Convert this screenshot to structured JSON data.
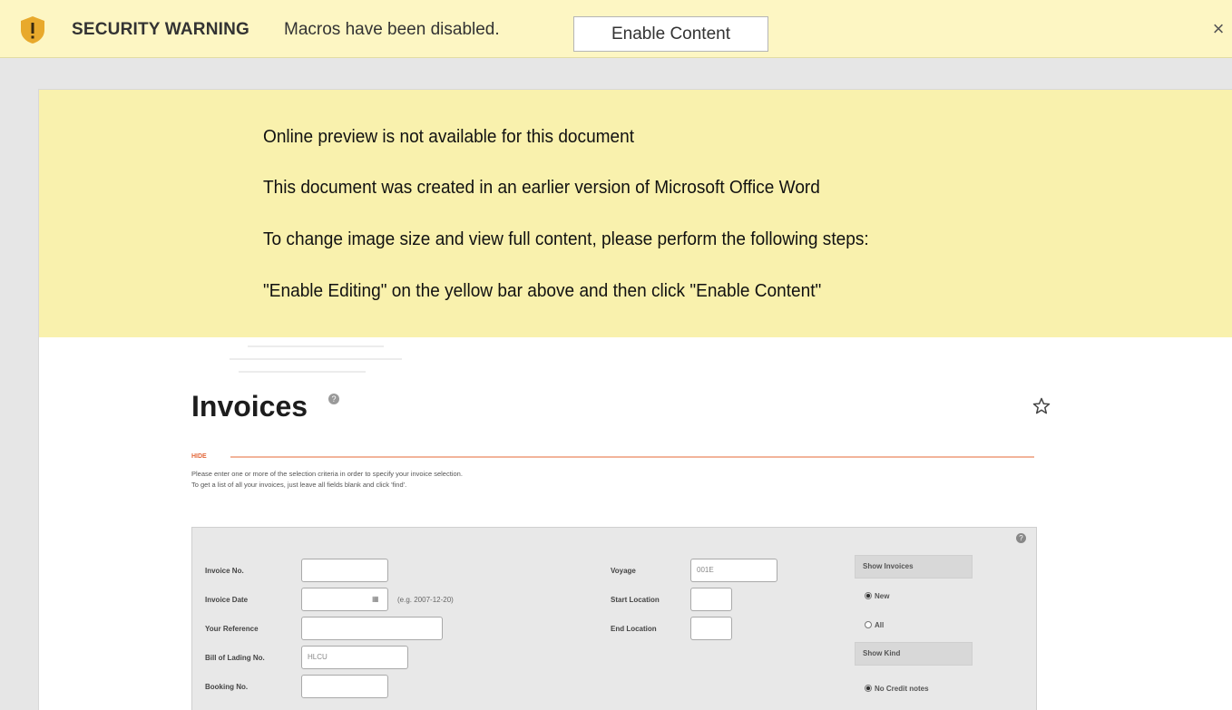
{
  "security_bar": {
    "title": "SECURITY WARNING",
    "message": "Macros have been disabled.",
    "button_label": "Enable Content",
    "close_glyph": "×",
    "shield_color": "#e8a92c"
  },
  "notice": {
    "lines": [
      "Online preview is not available for this document",
      "This document was created in an earlier version of Microsoft Office Word",
      "To change image size and view full content, please perform the following steps:",
      "\"Enable Editing\" on the yellow bar above and then click \"Enable Content\""
    ]
  },
  "invoice_screenshot": {
    "title": "Invoices",
    "help_glyph": "?",
    "hide_label": "HIDE",
    "instructions": [
      "Please enter one or more of the selection criteria in order to specify your invoice selection.",
      "To get a list of all your invoices, just leave all fields blank and click 'find'."
    ],
    "fields": {
      "invoice_no": {
        "label": "Invoice No.",
        "value": ""
      },
      "invoice_date": {
        "label": "Invoice Date",
        "value": "",
        "hint": "(e.g. 2007-12-20)"
      },
      "your_reference": {
        "label": "Your Reference",
        "value": ""
      },
      "bill_of_lading": {
        "label": "Bill of Lading No.",
        "value": "HLCU"
      },
      "booking_no": {
        "label": "Booking No.",
        "value": ""
      },
      "voyage": {
        "label": "Voyage",
        "value": "001E"
      },
      "start_location": {
        "label": "Start Location",
        "value": ""
      },
      "end_location": {
        "label": "End Location",
        "value": ""
      }
    },
    "show_invoices": {
      "heading": "Show Invoices",
      "options": [
        {
          "label": "New",
          "selected": true
        },
        {
          "label": "All",
          "selected": false
        }
      ]
    },
    "show_kind": {
      "heading": "Show Kind",
      "options": [
        {
          "label": "No Credit notes",
          "selected": true
        }
      ]
    }
  }
}
